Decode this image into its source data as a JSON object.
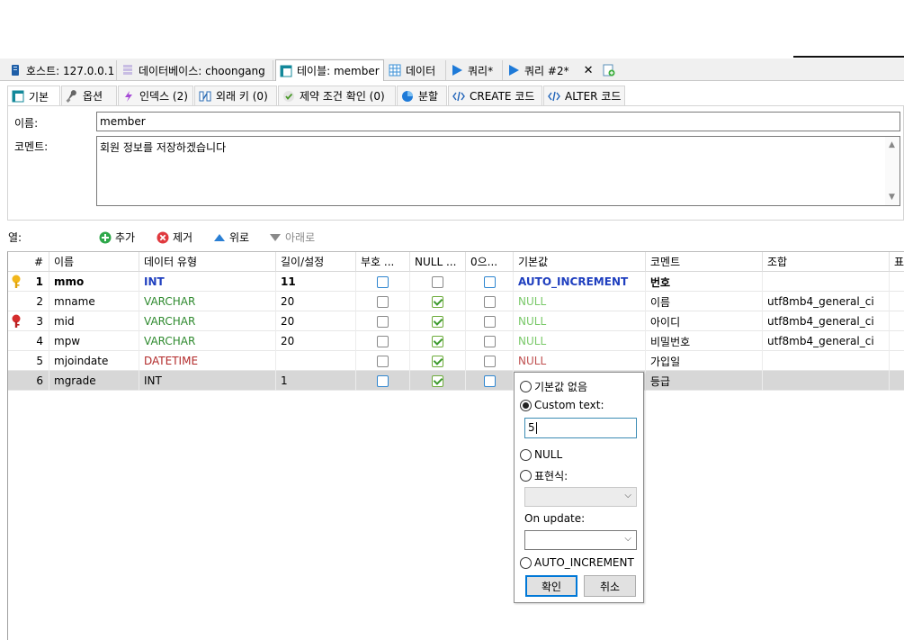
{
  "tabs": [
    {
      "label": "호스트: 127.0.0.1",
      "icon": "server-icon"
    },
    {
      "label": "데이터베이스: choongang",
      "icon": "database-icon"
    },
    {
      "label": "테이블: member",
      "icon": "table-icon"
    },
    {
      "label": "데이터",
      "icon": "grid-icon"
    },
    {
      "label": "쿼리*",
      "icon": "play-icon"
    },
    {
      "label": "쿼리 #2*",
      "icon": "play-icon"
    }
  ],
  "close_label": "✕",
  "subtabs": [
    {
      "label": "기본",
      "icon": "table-icon"
    },
    {
      "label": "옵션",
      "icon": "wrench-icon"
    },
    {
      "label": "인덱스 (2)",
      "icon": "lightning-icon"
    },
    {
      "label": "외래 키 (0)",
      "icon": "foreign-key-icon"
    },
    {
      "label": "제약 조건 확인 (0)",
      "icon": "check-icon"
    },
    {
      "label": "분할",
      "icon": "pie-icon"
    },
    {
      "label": "CREATE 코드",
      "icon": "code-icon"
    },
    {
      "label": "ALTER 코드",
      "icon": "code-icon"
    }
  ],
  "form": {
    "name_label": "이름:",
    "name_value": "member",
    "comment_label": "코멘트:",
    "comment_value": "회원 정보를 저장하겠습니다"
  },
  "columns_toolbar": {
    "label": "열:",
    "add": "추가",
    "remove": "제거",
    "up": "위로",
    "down": "아래로"
  },
  "grid": {
    "headers": [
      "#",
      "이름",
      "데이터 유형",
      "길이/설정",
      "부호 ...",
      "NULL ...",
      "0으...",
      "기본값",
      "코멘트",
      "조합",
      "표"
    ],
    "rows": [
      {
        "num": "1",
        "name": "mmo",
        "type": "INT",
        "length": "11",
        "unsigned": false,
        "nullable": false,
        "zerofill": false,
        "default": "AUTO_INCREMENT",
        "comment": "번호",
        "collation": "",
        "key": "primary",
        "bold": true
      },
      {
        "num": "2",
        "name": "mname",
        "type": "VARCHAR",
        "length": "20",
        "unsigned": false,
        "nullable": true,
        "zerofill": false,
        "default": "NULL",
        "comment": "이름",
        "collation": "utf8mb4_general_ci",
        "key": "",
        "bold": false
      },
      {
        "num": "3",
        "name": "mid",
        "type": "VARCHAR",
        "length": "20",
        "unsigned": false,
        "nullable": true,
        "zerofill": false,
        "default": "NULL",
        "comment": "아이디",
        "collation": "utf8mb4_general_ci",
        "key": "unique",
        "bold": false
      },
      {
        "num": "4",
        "name": "mpw",
        "type": "VARCHAR",
        "length": "20",
        "unsigned": false,
        "nullable": true,
        "zerofill": false,
        "default": "NULL",
        "comment": "비밀번호",
        "collation": "utf8mb4_general_ci",
        "key": "",
        "bold": false
      },
      {
        "num": "5",
        "name": "mjoindate",
        "type": "DATETIME",
        "length": "",
        "unsigned": false,
        "nullable": true,
        "zerofill": false,
        "default": "NULL",
        "comment": "가입일",
        "collation": "",
        "key": "",
        "bold": false
      },
      {
        "num": "6",
        "name": "mgrade",
        "type": "INT",
        "length": "1",
        "unsigned": false,
        "nullable": true,
        "zerofill": false,
        "default": "",
        "comment": "등급",
        "collation": "",
        "key": "",
        "bold": false
      }
    ]
  },
  "popup": {
    "no_default": "기본값 없음",
    "custom_text": "Custom text:",
    "custom_value": "5",
    "null_label": "NULL",
    "expression": "표현식:",
    "on_update": "On update:",
    "auto_increment": "AUTO_INCREMENT",
    "ok": "확인",
    "cancel": "취소"
  },
  "colors": {
    "type_int": "#1f3fbf",
    "type_varchar": "#2f8a2f",
    "type_datetime": "#b22a2a",
    "default_auto": "#1f3fbf",
    "default_null": "#7ac96a",
    "default_null_dt": "#c05050"
  }
}
